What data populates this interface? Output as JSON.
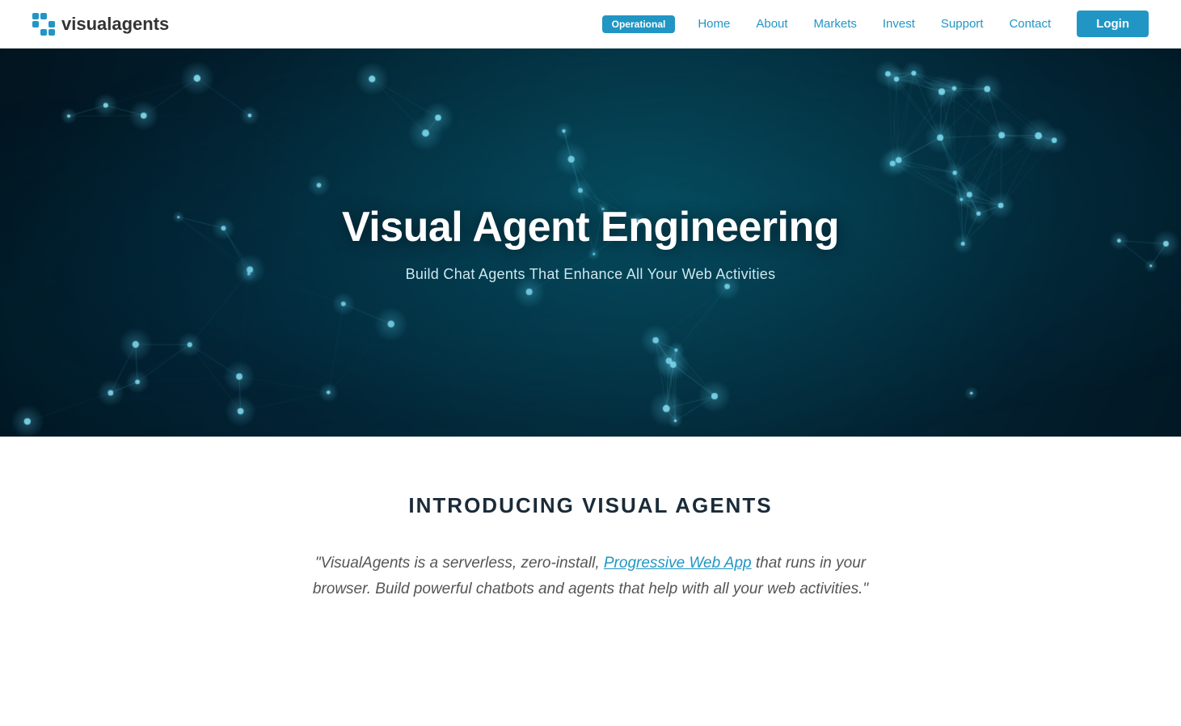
{
  "logo": {
    "visual_text": "visual",
    "agents_text": "agents"
  },
  "navbar": {
    "status_badge": "Operational",
    "links": [
      {
        "label": "Home",
        "name": "home"
      },
      {
        "label": "About",
        "name": "about"
      },
      {
        "label": "Markets",
        "name": "markets"
      },
      {
        "label": "Invest",
        "name": "invest"
      },
      {
        "label": "Support",
        "name": "support"
      },
      {
        "label": "Contact",
        "name": "contact"
      }
    ],
    "login_label": "Login"
  },
  "hero": {
    "title": "Visual Agent Engineering",
    "subtitle": "Build Chat Agents That Enhance All Your Web Activities"
  },
  "intro": {
    "heading": "INTRODUCING VISUAL AGENTS",
    "quote_before": "\"VisualAgents is a serverless, zero-install, ",
    "quote_link": "Progressive Web App",
    "quote_after": " that runs in your browser. Build powerful chatbots and agents that help with all your web activities.\""
  },
  "colors": {
    "accent": "#2196c4",
    "hero_bg": "#020f18",
    "text_dark": "#1a2a38"
  }
}
